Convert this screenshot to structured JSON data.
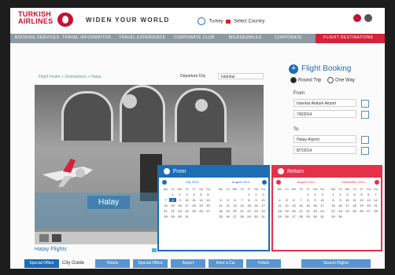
{
  "header": {
    "logo_line1": "TURKISH",
    "logo_line2": "AIRLINES",
    "slogan": "WIDEN YOUR WORLD",
    "country": "Turkey",
    "select_country": "Select Country"
  },
  "nav": {
    "items": [
      "BOOKING SERVICES",
      "TRAVEL INFORMATION",
      "TRAVEL EXPERIENCE",
      "CORPORATE CLUB",
      "MILES&SMILES",
      "CORPORATE"
    ],
    "special": "FLIGHT DESTINATIONS"
  },
  "breadcrumb": "Flight Finder  »  Destinations  »  Hatay",
  "departure": {
    "label": "Departure City",
    "value": "Istanbul"
  },
  "hero": {
    "label": "Hatay"
  },
  "caption": "Hatay Flights",
  "social": {
    "tweet": "Tweet",
    "count": "0"
  },
  "booking": {
    "title": "Flight Booking",
    "round_trip": "Round Trip",
    "one_way": "One Way",
    "from_label": "From",
    "from_value": "Istanbul Ataturk Airport",
    "from_date": "7/8/2014",
    "to_label": "To",
    "to_value": "Hatay Airport",
    "to_date": "8/7/2014"
  },
  "calendars": [
    {
      "title": "From",
      "months": [
        {
          "name": "July 2014",
          "days_header": [
            "Mo",
            "Tu",
            "We",
            "Th",
            "Fr",
            "Sa",
            "Su"
          ],
          "rows": [
            [
              "",
              "1",
              "2",
              "3",
              "4",
              "5",
              "6"
            ],
            [
              "7",
              "8",
              "9",
              "10",
              "11",
              "12",
              "13"
            ],
            [
              "14",
              "15",
              "16",
              "17",
              "18",
              "19",
              "20"
            ],
            [
              "21",
              "22",
              "23",
              "24",
              "25",
              "26",
              "27"
            ],
            [
              "28",
              "29",
              "30",
              "31",
              "",
              "",
              ""
            ]
          ],
          "selected": "8"
        },
        {
          "name": "August 2014",
          "days_header": [
            "Mo",
            "Tu",
            "We",
            "Th",
            "Fr",
            "Sa",
            "Su"
          ],
          "rows": [
            [
              "",
              "",
              "",
              "",
              "1",
              "2",
              "3"
            ],
            [
              "4",
              "5",
              "6",
              "7",
              "8",
              "9",
              "10"
            ],
            [
              "11",
              "12",
              "13",
              "14",
              "15",
              "16",
              "17"
            ],
            [
              "18",
              "19",
              "20",
              "21",
              "22",
              "23",
              "24"
            ],
            [
              "25",
              "26",
              "27",
              "28",
              "29",
              "30",
              "31"
            ]
          ]
        }
      ]
    },
    {
      "title": "Return",
      "months": [
        {
          "name": "August 2014",
          "days_header": [
            "Mo",
            "Tu",
            "We",
            "Th",
            "Fr",
            "Sa",
            "Su"
          ],
          "rows": [
            [
              "",
              "",
              "",
              "",
              "1",
              "2",
              "3"
            ],
            [
              "4",
              "5",
              "6",
              "7",
              "8",
              "9",
              "10"
            ],
            [
              "11",
              "12",
              "13",
              "14",
              "15",
              "16",
              "17"
            ],
            [
              "18",
              "19",
              "20",
              "21",
              "22",
              "23",
              "24"
            ],
            [
              "25",
              "26",
              "27",
              "28",
              "29",
              "30",
              "31"
            ]
          ]
        },
        {
          "name": "September 2014",
          "days_header": [
            "Mo",
            "Tu",
            "We",
            "Th",
            "Fr",
            "Sa",
            "Su"
          ],
          "rows": [
            [
              "1",
              "2",
              "3",
              "4",
              "5",
              "6",
              "7"
            ],
            [
              "8",
              "9",
              "10",
              "11",
              "12",
              "13",
              "14"
            ],
            [
              "15",
              "16",
              "17",
              "18",
              "19",
              "20",
              "21"
            ],
            [
              "22",
              "23",
              "24",
              "25",
              "26",
              "27",
              "28"
            ],
            [
              "29",
              "30",
              "",
              "",
              "",
              "",
              ""
            ]
          ]
        }
      ]
    }
  ],
  "footer": {
    "special_offers": "Special Offers",
    "city_guide": "City Guide",
    "buttons": [
      "Hotels",
      "Special Offers",
      "Airport",
      "Rent a Car",
      "Hotels"
    ],
    "search": "Search Flights"
  },
  "colors": {
    "brand_red": "#c8102e",
    "brand_blue": "#1d6db5",
    "return_red": "#e5304a",
    "nav_gray": "#8e9aa3"
  }
}
